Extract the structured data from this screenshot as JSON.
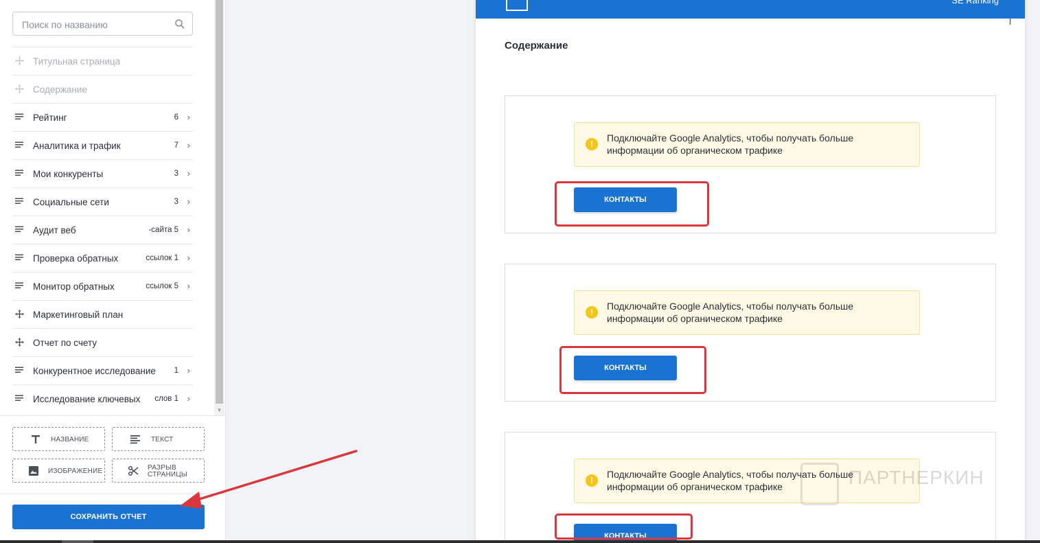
{
  "sidebar": {
    "search": {
      "placeholder": "Поиск по названию"
    },
    "items": [
      {
        "label": "Титульная страница",
        "count": "",
        "icon": "drag-move-icon",
        "disabled": true
      },
      {
        "label": "Содержание",
        "count": "",
        "icon": "drag-move-icon",
        "disabled": true
      },
      {
        "label": "Рейтинг",
        "count": "6",
        "icon": "list-lines-icon",
        "disabled": false
      },
      {
        "label": "Аналитика и трафик",
        "count": "7",
        "icon": "list-lines-icon",
        "disabled": false
      },
      {
        "label": "Мои конкуренты",
        "count": "3",
        "icon": "list-lines-icon",
        "disabled": false
      },
      {
        "label": "Социальные сети",
        "count": "3",
        "icon": "list-lines-icon",
        "disabled": false
      },
      {
        "label": "Аудит веб",
        "count": "-сайта 5",
        "icon": "list-lines-icon",
        "disabled": false
      },
      {
        "label": "Проверка обратных",
        "count": "ссылок 1",
        "icon": "list-lines-icon",
        "disabled": false
      },
      {
        "label": "Монитор обратных",
        "count": "ссылок 5",
        "icon": "list-lines-icon",
        "disabled": false
      },
      {
        "label": "Маркетинговый план",
        "count": "",
        "icon": "drag-move-icon",
        "disabled": false
      },
      {
        "label": "Отчет по счету",
        "count": "",
        "icon": "drag-move-icon",
        "disabled": false
      },
      {
        "label": "Конкурентное исследование",
        "count": "1",
        "icon": "list-lines-icon",
        "disabled": false
      },
      {
        "label": "Исследование ключевых",
        "count": "слов 1",
        "icon": "list-lines-icon",
        "disabled": false
      }
    ],
    "chevron": "›",
    "blocks": {
      "title": "НАЗВАНИЕ",
      "text": "ТЕКСТ",
      "image": "ИЗОБРАЖЕНИЕ",
      "page_break_line1": "РАЗРЫВ",
      "page_break_line2": "СТРАНИЦЫ"
    },
    "save_label": "СОХРАНИТЬ ОТЧЕТ"
  },
  "preview": {
    "brand": "SE Ranking",
    "page_title": "Содержание",
    "cards": [
      {
        "alert_line1": "Подключайте Google Analytics, чтобы получать больше",
        "alert_line2": "информации об органическом трафике",
        "button": "КОНТАКТЫ"
      },
      {
        "alert_line1": "Подключайте Google Analytics, чтобы получать больше",
        "alert_line2": "информации об органическом трафике",
        "button": "КОНТАКТЫ"
      },
      {
        "alert_line1": "Подключайте Google Analytics, чтобы получать больше",
        "alert_line2": "информации об органическом трафике",
        "button": "КОНТАКТЫ"
      }
    ],
    "alert_icon": "!"
  },
  "watermark": "ПАРТНЕРКИН",
  "colors": {
    "primary": "#1a73d2",
    "annotation_red": "#d9373d",
    "alert_bg": "#fff9e6",
    "alert_icon": "#f5c518"
  }
}
